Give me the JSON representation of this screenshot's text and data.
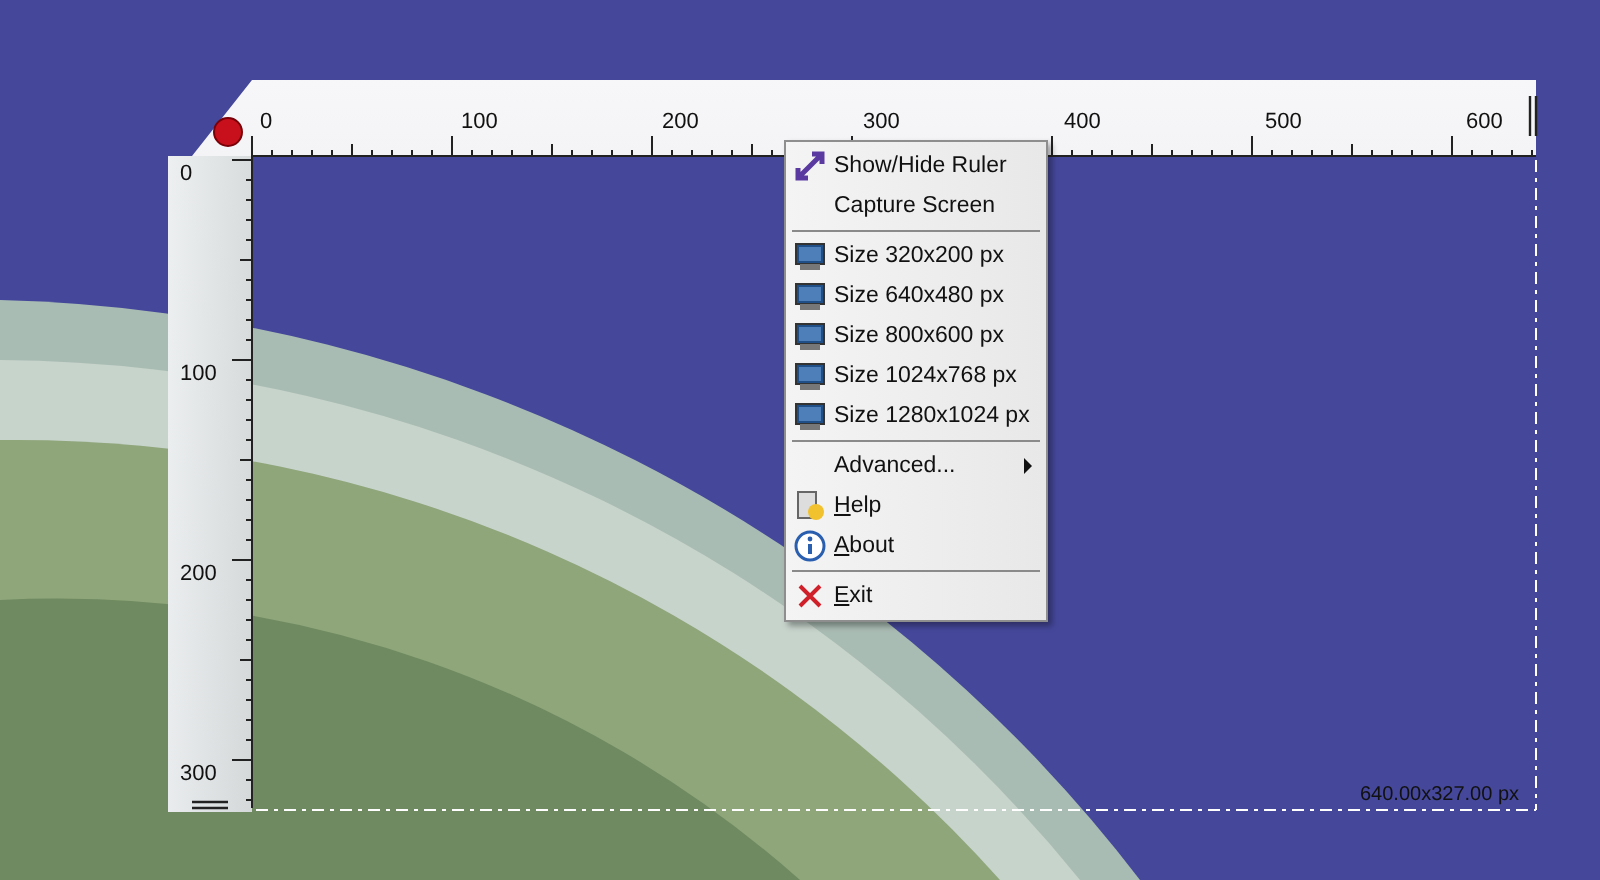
{
  "ruler": {
    "top_labels": [
      "0",
      "100",
      "200",
      "300",
      "400",
      "500",
      "600"
    ],
    "left_labels": [
      "0",
      "100",
      "200",
      "300"
    ]
  },
  "selection": {
    "size": "640.00x327.00 px"
  },
  "context_menu": {
    "items": [
      {
        "kind": "ruler",
        "label": "Show/Hide Ruler",
        "underline_first": false
      },
      {
        "kind": "plain",
        "label": "Capture Screen",
        "underline_first": false
      },
      {
        "kind": "separator"
      },
      {
        "kind": "monitor",
        "label": "Size 320x200 px",
        "underline_first": false
      },
      {
        "kind": "monitor",
        "label": "Size 640x480 px",
        "underline_first": false
      },
      {
        "kind": "monitor",
        "label": "Size 800x600 px",
        "underline_first": false
      },
      {
        "kind": "monitor",
        "label": "Size 1024x768 px",
        "underline_first": false
      },
      {
        "kind": "monitor",
        "label": "Size 1280x1024 px",
        "underline_first": false
      },
      {
        "kind": "separator"
      },
      {
        "kind": "submenu",
        "label": "Advanced...",
        "underline_first": false
      },
      {
        "kind": "help",
        "label": "Help",
        "underline_first": true
      },
      {
        "kind": "about",
        "label": "About",
        "underline_first": true
      },
      {
        "kind": "separator"
      },
      {
        "kind": "exit",
        "label": "Exit",
        "underline_first": true
      }
    ]
  }
}
